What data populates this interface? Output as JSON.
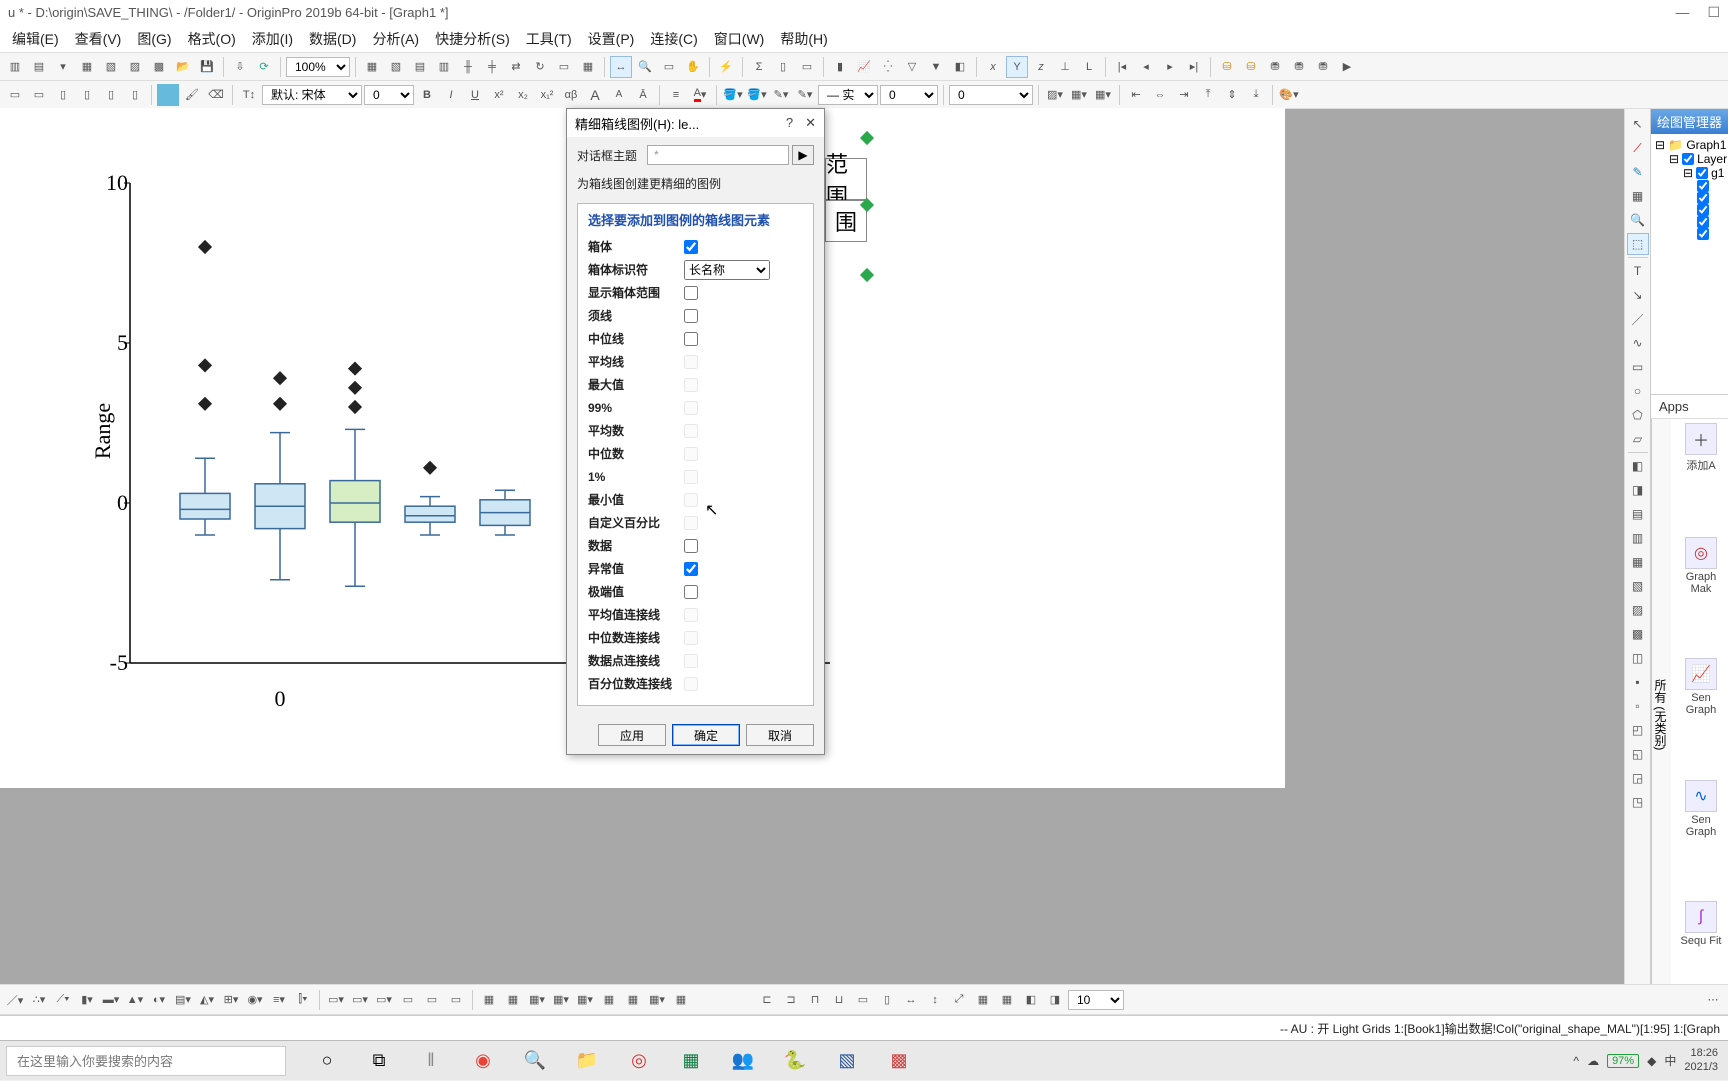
{
  "title": "u * - D:\\origin\\SAVE_THING\\ - /Folder1/ - OriginPro 2019b 64-bit - [Graph1 *]",
  "menu": [
    "",
    "编辑(E)",
    "查看(V)",
    "图(G)",
    "格式(O)",
    "添加(I)",
    "数据(D)",
    "分析(A)",
    "快捷分析(S)",
    "工具(T)",
    "设置(P)",
    "连接(C)",
    "窗口(W)",
    "帮助(H)"
  ],
  "toolbar1": {
    "zoom": "100%"
  },
  "toolbar2": {
    "font_label": "默认: 宋体",
    "font_size": "0",
    "line_style": "— 实",
    "line_w1": "0",
    "line_w2": "0"
  },
  "chart_data": {
    "type": "box",
    "ylabel": "Range",
    "yticks": [
      -5,
      0,
      5,
      10
    ],
    "ylim": [
      -5,
      10
    ],
    "x_categories": [
      "0"
    ],
    "series": [
      {
        "q1": -0.5,
        "median": -0.2,
        "q3": 0.3,
        "whisker_low": -1.0,
        "whisker_high": 1.4,
        "outliers": [
          3.1,
          4.3,
          8.0
        ],
        "fill": "#cfe6f5"
      },
      {
        "q1": -0.8,
        "median": -0.1,
        "q3": 0.6,
        "whisker_low": -2.4,
        "whisker_high": 2.2,
        "outliers": [
          3.1,
          3.9
        ],
        "fill": "#cfe6f5"
      },
      {
        "q1": -0.6,
        "median": 0.0,
        "q3": 0.7,
        "whisker_low": -2.6,
        "whisker_high": 2.3,
        "outliers": [
          3.0,
          3.6,
          4.2
        ],
        "fill": "#d7edc3"
      },
      {
        "q1": -0.6,
        "median": -0.4,
        "q3": -0.1,
        "whisker_low": -1.0,
        "whisker_high": 0.2,
        "outliers": [
          1.1
        ],
        "fill": "#cfe6f5"
      },
      {
        "q1": -0.7,
        "median": -0.3,
        "q3": 0.1,
        "whisker_low": -1.0,
        "whisker_high": 0.4,
        "outliers": [],
        "fill": "#cfe6f5"
      }
    ]
  },
  "dialog": {
    "title": "精细箱线图例(H): le...",
    "theme_label": "对话框主题",
    "theme_value": "*",
    "desc": "为箱线图创建更精细的图例",
    "section_title": "选择要添加到图例的箱线图元素",
    "options": [
      {
        "label": "箱体",
        "checked": true,
        "type": "check"
      },
      {
        "label": "箱体标识符",
        "type": "select",
        "value": "长名称"
      },
      {
        "label": "显示箱体范围",
        "checked": false,
        "type": "check"
      },
      {
        "label": "须线",
        "checked": false,
        "type": "check"
      },
      {
        "label": "中位线",
        "checked": false,
        "type": "check-gray"
      },
      {
        "label": "平均线",
        "checked": false,
        "type": "check-dis"
      },
      {
        "label": "最大值",
        "checked": false,
        "type": "check-dis"
      },
      {
        "label": "99%",
        "checked": false,
        "type": "check-dis"
      },
      {
        "label": "平均数",
        "checked": false,
        "type": "check-dis"
      },
      {
        "label": "中位数",
        "checked": false,
        "type": "check-dis"
      },
      {
        "label": "1%",
        "checked": false,
        "type": "check-dis"
      },
      {
        "label": "最小值",
        "checked": false,
        "type": "check-dis"
      },
      {
        "label": "自定义百分比",
        "checked": false,
        "type": "check-dis"
      },
      {
        "label": "数据",
        "checked": false,
        "type": "check"
      },
      {
        "label": "异常值",
        "checked": true,
        "type": "check"
      },
      {
        "label": "极端值",
        "checked": false,
        "type": "check"
      },
      {
        "label": "平均值连接线",
        "checked": false,
        "type": "check-dis"
      },
      {
        "label": "中位数连接线",
        "checked": false,
        "type": "check-dis"
      },
      {
        "label": "数据点连接线",
        "checked": false,
        "type": "check-dis"
      },
      {
        "label": "百分位数连接线",
        "checked": false,
        "type": "check-dis"
      }
    ],
    "btn_apply": "应用",
    "btn_ok": "确定",
    "btn_cancel": "取消"
  },
  "legend_fragment": "范围",
  "right_panel": {
    "title": "绘图管理器",
    "root": "Graph1",
    "layer": "Layer",
    "group": "g1"
  },
  "apps": {
    "title": "Apps",
    "side_tab": "所有 (无类别)",
    "item_add": "添加A",
    "items": [
      "Graph Mak",
      "Sen Graph",
      "Sen Graph",
      "Sequ Fit"
    ]
  },
  "bottom_combo": "10",
  "status": {
    "au": "-- AU : 开 Light Grids 1:[Book1]输出数据!Col(\"original_shape_MAL\")[1:95] 1:[Graph",
    "battery": "97%",
    "ime": "中",
    "time": "18:26",
    "date": "2021/3"
  },
  "taskbar": {
    "search_placeholder": "在这里输入你要搜索的内容"
  }
}
